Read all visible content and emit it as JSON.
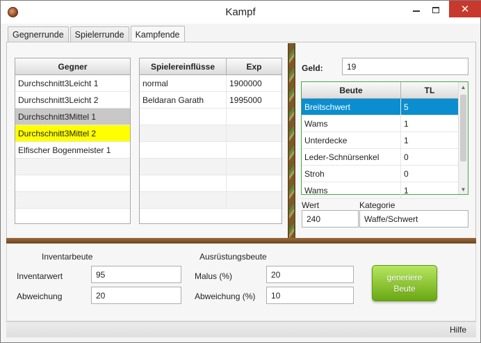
{
  "window": {
    "title": "Kampf"
  },
  "tabs": [
    {
      "label": "Gegnerrunde"
    },
    {
      "label": "Spielerrunde"
    },
    {
      "label": "Kampfende"
    }
  ],
  "gegner_table": {
    "header": "Gegner",
    "rows": [
      "Durchschnitt3Leicht 1",
      "Durchschnitt3Leicht 2",
      "Durchschnitt3Mittel 1",
      "Durchschnitt3Mittel 2",
      "Elfischer Bogenmeister 1"
    ]
  },
  "spieler_table": {
    "headers": [
      "Spielereinflüsse",
      "Exp"
    ],
    "rows": [
      [
        "normal",
        "1900000"
      ],
      [
        "Beldaran Garath",
        "1995000"
      ]
    ]
  },
  "geld": {
    "label": "Geld:",
    "value": "19"
  },
  "beute_table": {
    "headers": [
      "Beute",
      "TL"
    ],
    "rows": [
      [
        "Breitschwert",
        "5"
      ],
      [
        "Wams",
        "1"
      ],
      [
        "Unterdecke",
        "1"
      ],
      [
        "Leder-Schnürsenkel",
        "0"
      ],
      [
        "Stroh",
        "0"
      ],
      [
        "Wams",
        "1"
      ]
    ]
  },
  "wert": {
    "label": "Wert",
    "value": "240"
  },
  "kategorie": {
    "label": "Kategorie",
    "value": "Waffe/Schwert"
  },
  "inventarbeute": {
    "heading": "Inventarbeute",
    "inventarwert_label": "Inventarwert",
    "inventarwert_value": "95",
    "abweichung_label": "Abweichung",
    "abweichung_value": "20"
  },
  "ausruestungsbeute": {
    "heading": "Ausrüstungsbeute",
    "malus_label": "Malus (%)",
    "malus_value": "20",
    "abweichung_label": "Abweichung (%)",
    "abweichung_value": "10"
  },
  "generate_button": {
    "line1": "generiere",
    "line2": "Beute"
  },
  "statusbar": {
    "help_label": "Hilfe"
  },
  "colors": {
    "selected_blue": "#0a8ed0",
    "selected_yellow": "#ffff00",
    "selected_grey": "#c8c8c8",
    "button_green": "#6aa812",
    "close_red": "#c7392d"
  }
}
